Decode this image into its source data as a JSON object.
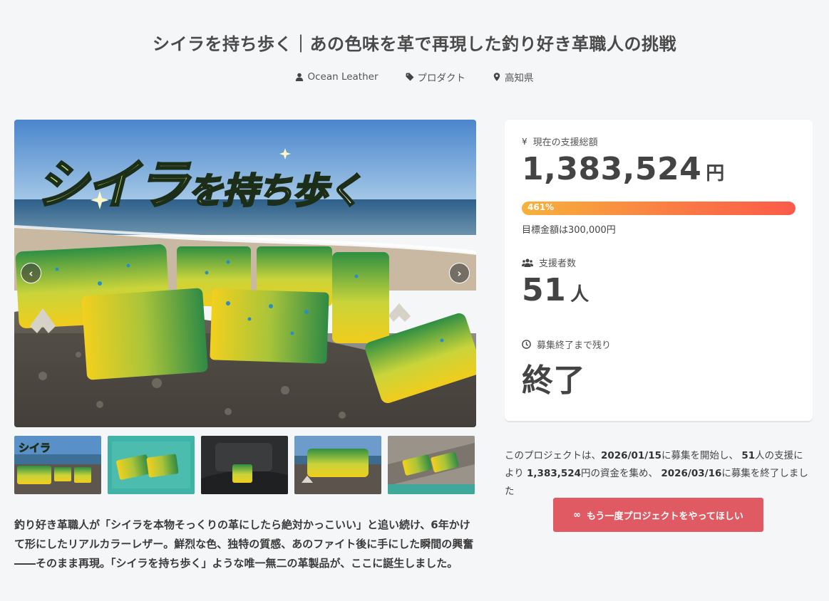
{
  "project": {
    "title": "シイラを持ち歩く｜あの色味を革で再現した釣り好き革職人の挑戦",
    "author": "Ocean Leather",
    "category": "プロダクト",
    "location": "高知県"
  },
  "hero": {
    "text_big": "シイラ",
    "text_small": "を持ち歩く",
    "prev_label": "‹",
    "next_label": "›"
  },
  "description": "釣り好き革職人が「シイラを本物そっくりの革にしたら絶対かっこいい」と追い続け、6年かけて形にしたリアルカラーレザー。鮮烈な色、独特の質感、あのファイト後に手にした瞬間の興奮――そのまま再現。「シイラを持ち歩く」ような唯一無二の革製品が、ここに誕生しました。",
  "stats": {
    "funded_label": "現在の支援総額",
    "funded_amount": "1,383,524",
    "funded_unit": "円",
    "percent": "461%",
    "goal_text": "目標金額は300,000円",
    "backers_label": "支援者数",
    "backers_count": "51",
    "backers_unit": "人",
    "remaining_label": "募集終了まで残り",
    "remaining_value": "終了"
  },
  "summary": {
    "p1": "このプロジェクトは、",
    "start_date": "2026/01/15",
    "p2": "に募集を開始し、",
    "backers": "51",
    "p3": "人の支援により",
    "amount": "1,383,524",
    "p4": "円の資金を集め、",
    "end_date": "2026/03/16",
    "p5": "に募集を終了しました"
  },
  "cta": {
    "icon": "∞",
    "label": "もう一度プロジェクトをやってほしい"
  },
  "colors": {
    "accent": "#e05a63",
    "progress_start": "#f7b23b",
    "progress_end": "#fb5a4a",
    "text": "#444444"
  }
}
